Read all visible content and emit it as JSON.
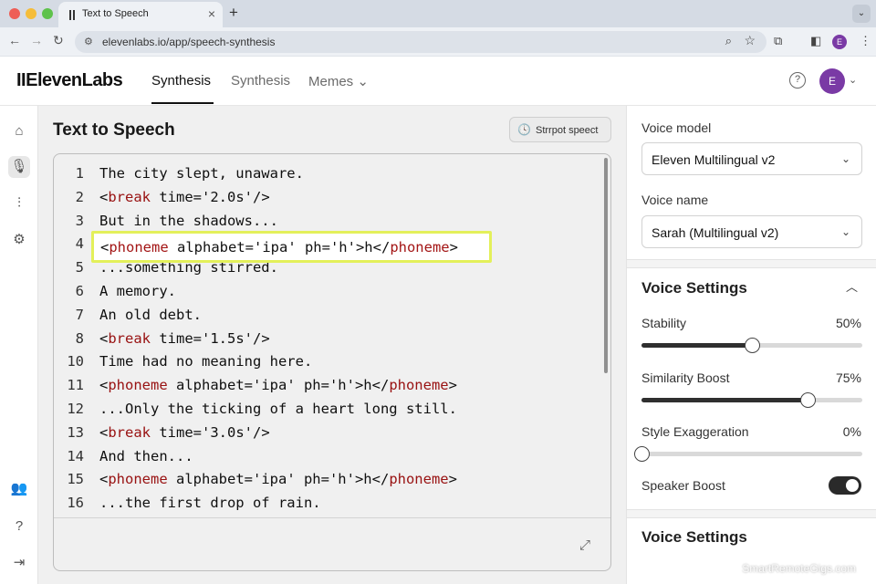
{
  "browser": {
    "tab_title": "Text to Speech",
    "tab_close": "×",
    "new_tab": "+",
    "tab_dropdown": "⌄",
    "url": "elevenlabs.io/app/speech-synthesis",
    "avatar_letter": "E"
  },
  "header": {
    "logo": "IIElevenLabs",
    "nav": [
      {
        "label": "Synthesis",
        "active": true
      },
      {
        "label": "Synthesis",
        "active": false
      },
      {
        "label": "Memes ⌄",
        "active": false
      }
    ],
    "help": "?",
    "avatar_letter": "E",
    "avatar_color": "#7a3aa5"
  },
  "main": {
    "title": "Text to Speech",
    "history_button": "Strrpot speect",
    "lines": [
      {
        "n": "1",
        "text": "The city slept, unaware."
      },
      {
        "n": "2",
        "text": "<break time='2.0s'/>"
      },
      {
        "n": "3",
        "text": "But in the shadows..."
      },
      {
        "n": "4",
        "text": "<phoneme alphabet='ipa' ph='h'>h</phoneme>"
      },
      {
        "n": "5",
        "text": "...something stirred."
      },
      {
        "n": "6",
        "text": "A memory."
      },
      {
        "n": "7",
        "text": "An old debt."
      },
      {
        "n": "8",
        "text": "<break time='1.5s'/>"
      },
      {
        "n": "10",
        "text": "Time had no meaning here."
      },
      {
        "n": "11",
        "text": "<phoneme alphabet='ipa' ph='h'>h</phoneme>"
      },
      {
        "n": "12",
        "text": "...Only the ticking of a heart long still."
      },
      {
        "n": "13",
        "text": "<break time='3.0s'/>"
      },
      {
        "n": "14",
        "text": "And then..."
      },
      {
        "n": "15",
        "text": "<phoneme alphabet='ipa' ph='h'>h</phoneme>"
      },
      {
        "n": "16",
        "text": "...the first drop of rain."
      }
    ],
    "highlighted_line_index": 3,
    "highlight_color": "#e3f05a"
  },
  "settings": {
    "voice_model_label": "Voice model",
    "voice_model_value": "Eleven Multilingual v2",
    "voice_name_label": "Voice name",
    "voice_name_value": "Sarah (Multilingual v2)",
    "voice_settings_heading": "Voice Settings",
    "sliders": [
      {
        "label": "Stability",
        "value_text": "50%",
        "value": 0.5
      },
      {
        "label": "Similarity Boost",
        "value_text": "75%",
        "value": 0.75
      },
      {
        "label": "Style Exaggeration",
        "value_text": "0%",
        "value": 0.0
      }
    ],
    "speaker_boost_label": "Speaker Boost",
    "speaker_boost_on": true,
    "second_heading": "Voice Settings"
  },
  "watermark": "SmartRemoteGigs.com"
}
